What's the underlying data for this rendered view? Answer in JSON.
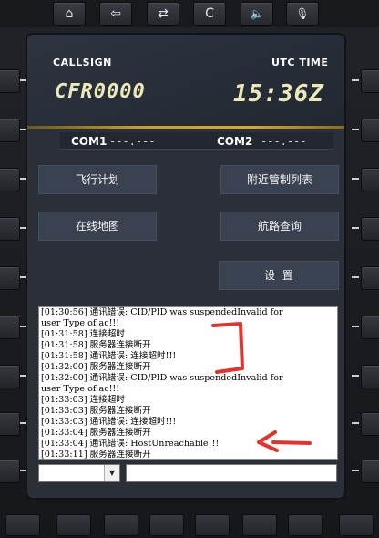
{
  "top_buttons": [
    {
      "icon": "home-icon",
      "glyph": "⌂"
    },
    {
      "icon": "back-arrow-icon",
      "glyph": "⇦"
    },
    {
      "icon": "swap-arrows-icon",
      "glyph": "⇄"
    },
    {
      "icon": "clear-icon",
      "glyph": "C"
    },
    {
      "icon": "speaker-icon",
      "glyph": "🔈"
    },
    {
      "icon": "microphone-icon",
      "glyph": "🎙"
    }
  ],
  "header": {
    "callsign_label": "CALLSIGN",
    "callsign_value": "CFR0000",
    "utc_label": "UTC TIME",
    "utc_value": "15:36Z"
  },
  "com": {
    "com1_label": "COM1",
    "com1_value": "---.---",
    "com2_label": "COM2",
    "com2_value": "---.---"
  },
  "menu": {
    "flight_plan": "飞行计划",
    "nearby_atc": "附近管制列表",
    "online_map": "在线地图",
    "route_query": "航路查询",
    "settings": "设  置"
  },
  "log_lines": [
    "[01:30:56] 通讯错误: CID/PID was suspendedInvalid for",
    "user Type of ac!!!",
    "[01:31:58] 连接超时",
    "[01:31:58] 服务器连接断开",
    "[01:31:58] 通讯错误: 连接超时!!!",
    "[01:32:00] 服务器连接断开",
    "[01:32:00] 通讯错误: CID/PID was suspendedInvalid for",
    "user Type of ac!!!",
    "[01:33:03] 连接超时",
    "[01:33:03] 服务器连接断开",
    "[01:33:03] 通讯错误: 连接超时!!!",
    "[01:33:04] 服务器连接断开",
    "[01:33:04] 通讯错误: HostUnreachable!!!",
    "[01:33:11] 服务器连接断开"
  ],
  "dropdown": {
    "selected": ""
  },
  "command_input": {
    "value": ""
  },
  "colors": {
    "accent_gold": "#d9ab24",
    "annotation_red": "#e8312a",
    "screen_bg": "#2a2f38"
  }
}
